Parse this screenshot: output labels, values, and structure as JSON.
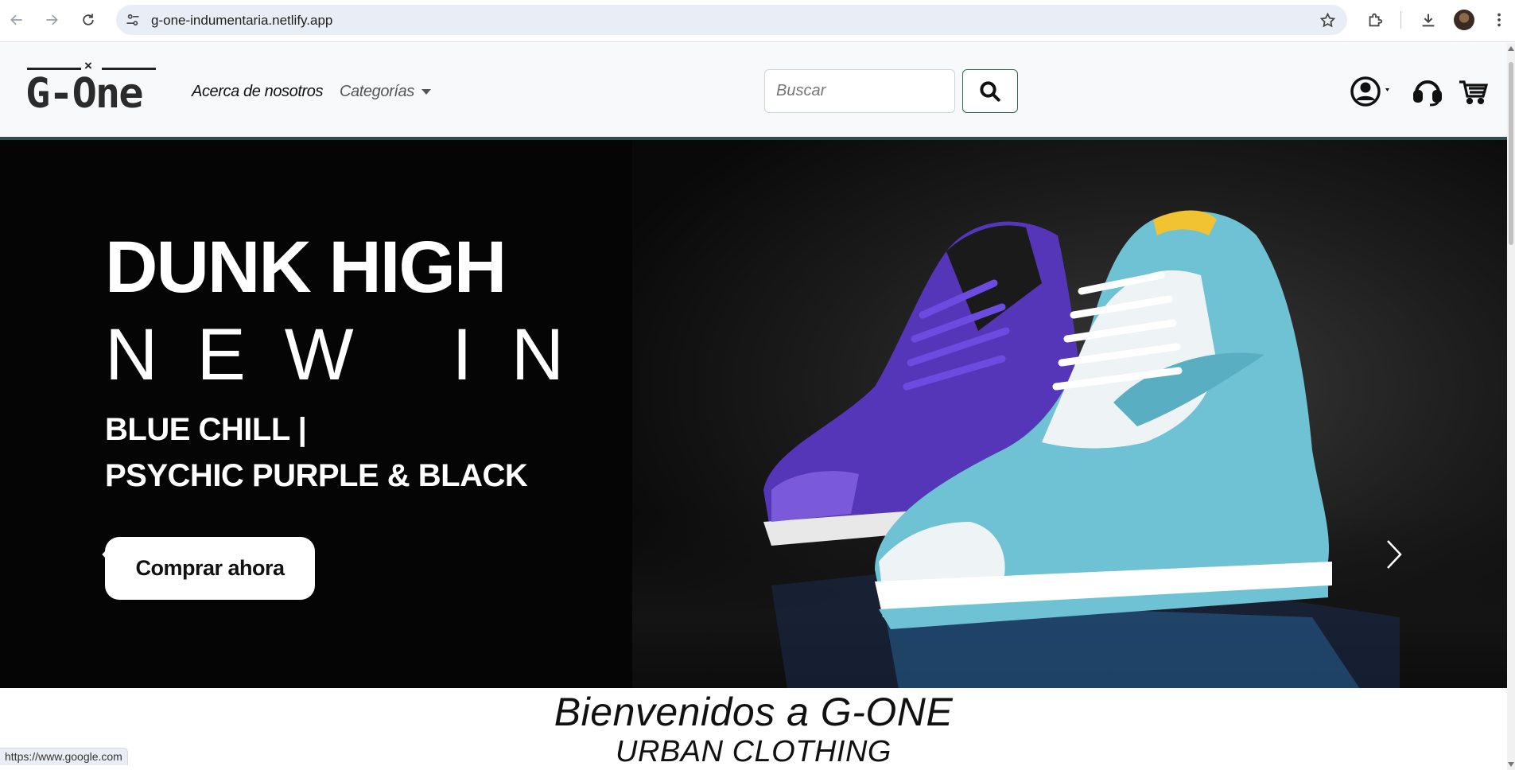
{
  "browser": {
    "url": "g-one-indumentaria.netlify.app",
    "icons": [
      "back-arrow-icon",
      "forward-arrow-icon",
      "reload-icon",
      "site-settings-icon",
      "bookmark-star-icon",
      "extensions-icon",
      "download-icon",
      "profile-avatar",
      "menu-kebab-icon"
    ]
  },
  "header": {
    "logo_text": "G-One",
    "logo_mark": "×",
    "nav": {
      "about_label": "Acerca de nosotros",
      "categories_label": "Categorías"
    },
    "search": {
      "placeholder": "Buscar"
    },
    "icons": [
      "user-account-icon",
      "support-headset-icon",
      "shopping-cart-icon"
    ],
    "border_color": "#2f4f4f"
  },
  "hero": {
    "title": "DUNK HIGH",
    "subtitle": "NEW IN",
    "line1": "BLUE CHILL |",
    "line2": "PSYCHIC PURPLE & BLACK",
    "cta_label": "Comprar ahora",
    "colors": {
      "background": "#050505",
      "text": "#ffffff",
      "sneaker_blue": "#6fc2d4",
      "sneaker_purple": "#5a3bc4"
    }
  },
  "welcome": {
    "title": "Bienvenidos a G-ONE",
    "subtitle": "URBAN CLOTHING"
  },
  "status_bar": {
    "text": "https://www.google.com"
  }
}
